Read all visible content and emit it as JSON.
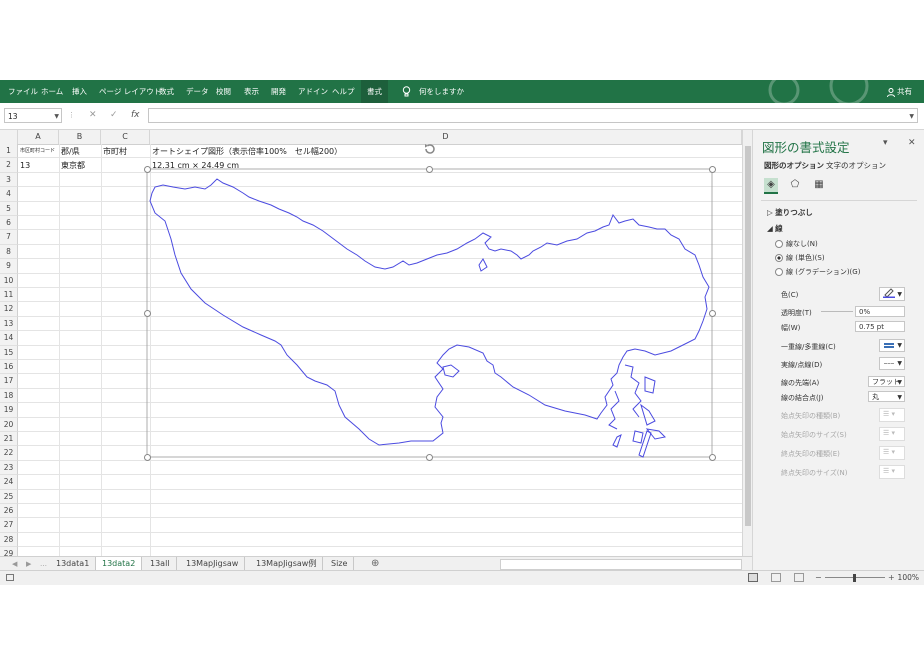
{
  "ribbon": {
    "tabs": [
      "ファイル",
      "ホーム",
      "挿入",
      "ページ レイアウト",
      "数式",
      "データ",
      "校閲",
      "表示",
      "開発",
      "アドイン",
      "ヘルプ"
    ],
    "active_tab": "書式",
    "tell_me": "何をしますか",
    "share": "共有"
  },
  "formula_bar": {
    "name_box": "13",
    "cancel": "✕",
    "enter": "✓",
    "fx": "fx",
    "formula": ""
  },
  "grid": {
    "columns": [
      "A",
      "B",
      "C",
      "D"
    ],
    "rows": [
      "1",
      "2",
      "3",
      "4",
      "5",
      "6",
      "7",
      "8",
      "9",
      "10",
      "11",
      "12",
      "13",
      "14",
      "15",
      "16",
      "17",
      "18",
      "19",
      "20",
      "21",
      "22",
      "23",
      "24",
      "25",
      "26",
      "27",
      "28",
      "29"
    ],
    "cells": {
      "a1": "市区町村コード",
      "b1": "郡/県",
      "c1": "市町村",
      "d1": "オートシェイプ図形（表示倍率100%　セル幅200）",
      "a2": "13",
      "b2": "東京都",
      "d2": "12.31 cm × 24.49 cm"
    }
  },
  "sheet_tabs": [
    "13data1",
    "13data2",
    "13all",
    "13MapJigsaw",
    "13MapJigsaw例",
    "Size"
  ],
  "active_sheet": "13data2",
  "status": {
    "zoom": "100%"
  },
  "pane": {
    "title": "図形の書式設定",
    "tabs": [
      "図形のオプション",
      "文字のオプション"
    ],
    "fill_section": "塗りつぶし",
    "line_section": "線",
    "radios": [
      "線なし(N)",
      "線 (単色)(S)",
      "線 (グラデーション)(G)"
    ],
    "selected_radio": 1,
    "props": {
      "color": "色(C)",
      "transparency": "透明度(T)",
      "transparency_value": "0%",
      "width": "幅(W)",
      "width_value": "0.75 pt",
      "compound": "一重線/多重線(C)",
      "dash": "実線/点線(D)",
      "cap": "線の先端(A)",
      "cap_value": "フラット",
      "join": "線の結合点(J)",
      "join_value": "丸",
      "begin_arrow_type": "始点矢印の種類(B)",
      "begin_arrow_size": "始点矢印のサイズ(S)",
      "end_arrow_type": "終点矢印の種類(E)",
      "end_arrow_size": "終点矢印のサイズ(N)"
    }
  },
  "colors": {
    "ribbon": "#217346",
    "outline": "#4b4be0",
    "accent": "#217346"
  }
}
